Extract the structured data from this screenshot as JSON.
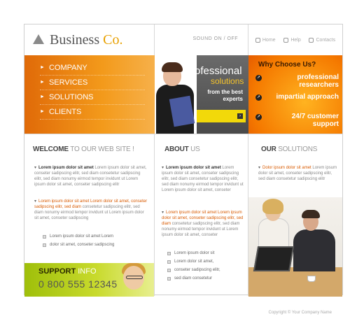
{
  "header": {
    "logo_main": "Business ",
    "logo_accent": "Co.",
    "sound_label": "SOUND ON / OFF",
    "links": [
      "Home",
      "Help",
      "Contacts"
    ]
  },
  "nav": {
    "items": [
      "COMPANY",
      "SERVICES",
      "SOLUTIONS",
      "CLIENTS"
    ]
  },
  "promo": {
    "line1": "Professional",
    "line2": "solutions",
    "line3": "from the best experts"
  },
  "why": {
    "title": "Why Choose Us?",
    "items": [
      "professional researchers",
      "impartial approach",
      "24/7 customer support"
    ]
  },
  "welcome": {
    "title_dark": "WELCOME",
    "title_light": " TO OUR WEB SITE !",
    "p1_bold": "Lorem ipsum dolor sit amet",
    "p1_rest": " Lorem ipsum dolor sit amet, conseter sadipscing elitr, sed diam consetetur sadipscing elitr, sed diam nonumy eirmod tempor invidunt ut Lorem ipsum dolor sit amet, conseter sadipscing elitr",
    "p2_orange": "Lorem ipsum dolor sit amet Lorem dolor sit amet, conseter sadipscing elitr, sed diam",
    "p2_rest": " consetetur sadipscing elitr, sed diam nonumy eirmod tempor invidunt ut Lorem ipsum dolor sit amet, conseter sadipscing",
    "checks": [
      "Lorem ipsum dolor sit amet Lorem",
      "dolor sit amet, conseter sadipscing"
    ]
  },
  "support": {
    "label_dark": "SUPPORT",
    "label_light": " INFO",
    "phone": "0 800 555 12345"
  },
  "about": {
    "title_dark": "ABOUT",
    "title_light": " US",
    "p1_bold": "Lorem ipsum dolor sit amet",
    "p1_rest": " Lorem ipsum dolor sit amet, conseter sadipscing elitr, sed diam consetetur sadipscing elitr, sed diam nonumy eirmod tempor invidunt ut Lorem ipsum dolor sit amet, conseter",
    "p2_orange": "Lorem ipsum dolor sit amet Lorem ipsum dolor sit amet, conseter sadipscing elitr, sed diam",
    "p2_rest": " consetetur sadipscing elitr, sed diam nonumy eirmod tempor invidunt ut Lorem ipsum dolor sit amet, conseter",
    "checks": [
      "Lorem ipsum dolor sit",
      "Lorem dolor sit amet,",
      "conseter sadipscing elitr,",
      "sed diam consetetur"
    ]
  },
  "solutions": {
    "title_dark": "OUR",
    "title_light": " SOLUTIONS",
    "p1_orange": "Dolor ipsum dolor sit amet",
    "p1_rest": " Lorem ipsum dolor sit amet, conseter sadipscing elitr, sed diam consetetur sadipscing elitr"
  },
  "footer": {
    "copyright": "Copyright © Your Company Name"
  },
  "colors": {
    "nav_orange": "#f39a1b",
    "accent_yellow": "#f2d90a",
    "support_green": "#9fbf0a",
    "link_orange": "#d85a00"
  }
}
